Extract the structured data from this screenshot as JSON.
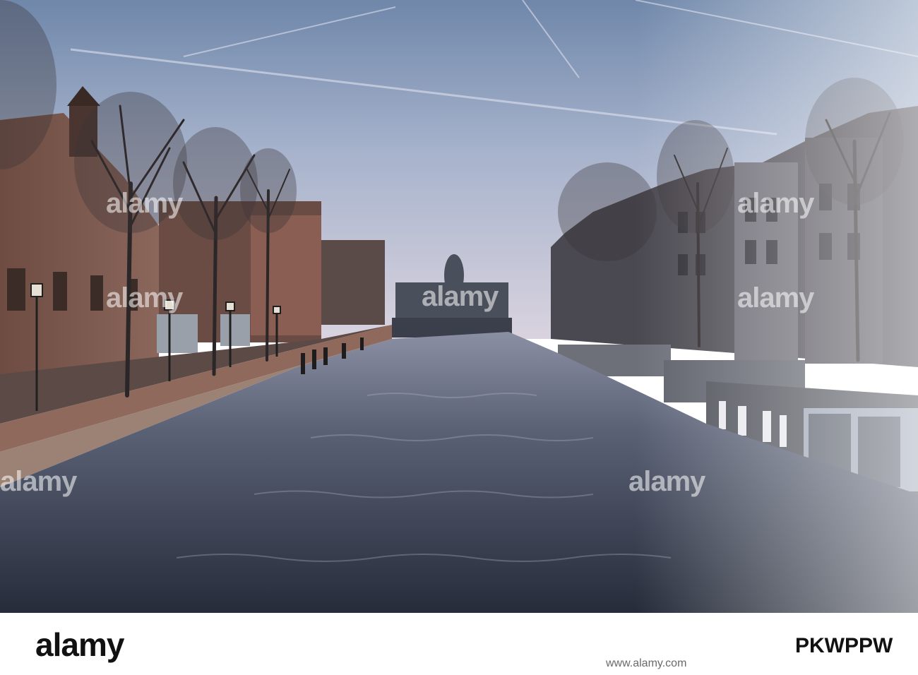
{
  "image": {
    "alt_text": "Amsterdam canal with bare trees, brick buildings, houseboats and a bridge in the distance"
  },
  "watermark": {
    "text": "alamy"
  },
  "footer": {
    "logo": "alamy",
    "image_id": "PKWPPW",
    "url": "www.alamy.com"
  },
  "colors": {
    "sky_top": "#6f87aa",
    "sky_bottom": "#d9d3df",
    "water": "#3d4557",
    "brick": "#7d5a4e",
    "footer_bg": "#ffffff"
  }
}
